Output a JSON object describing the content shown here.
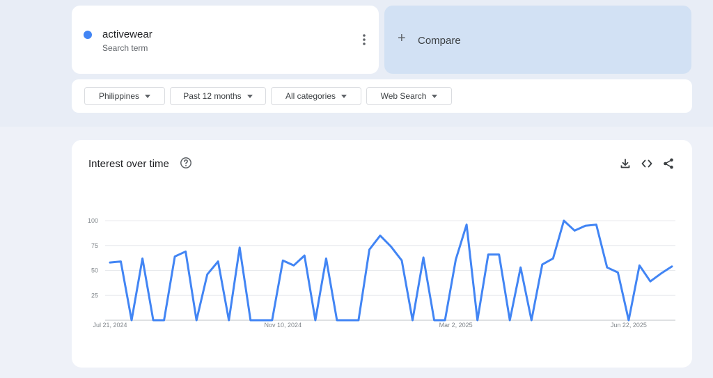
{
  "search_term": {
    "name": "activewear",
    "subtitle": "Search term",
    "color": "#4285f4"
  },
  "compare": {
    "plus": "+",
    "label": "Compare"
  },
  "filters": {
    "region": "Philippines",
    "time": "Past 12 months",
    "category": "All categories",
    "property": "Web Search"
  },
  "interest": {
    "title": "Interest over time",
    "icons": [
      "help-icon",
      "download-icon",
      "embed-icon",
      "share-icon"
    ]
  },
  "chart_data": {
    "type": "line",
    "title": "Interest over time",
    "ylim": [
      0,
      100
    ],
    "yticks": [
      25,
      50,
      75,
      100
    ],
    "xtick_labels": [
      "Jul 21, 2024",
      "Nov 10, 2024",
      "Mar 2, 2025",
      "Jun 22, 2025"
    ],
    "xtick_index": [
      0,
      16,
      32,
      48
    ],
    "grid": true,
    "series": [
      {
        "color": "#4285f4",
        "values": [
          58,
          59,
          0,
          62,
          0,
          0,
          64,
          69,
          0,
          46,
          59,
          0,
          73,
          0,
          0,
          0,
          60,
          55,
          65,
          0,
          62,
          0,
          0,
          0,
          71,
          85,
          74,
          60,
          0,
          63,
          0,
          0,
          61,
          96,
          0,
          66,
          66,
          0,
          53,
          0,
          56,
          62,
          100,
          90,
          95,
          96,
          53,
          48,
          0,
          55,
          39,
          47,
          54
        ]
      }
    ]
  }
}
